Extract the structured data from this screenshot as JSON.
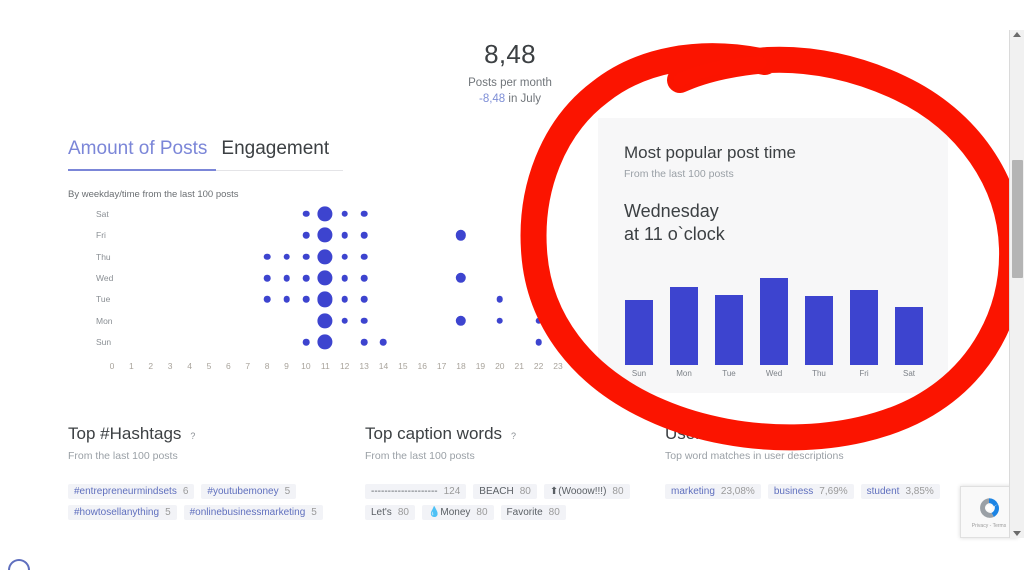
{
  "kpi": {
    "value": "8,48",
    "label": "Posts per month",
    "delta_value": "-8,48",
    "delta_suffix": " in July"
  },
  "tabs": [
    {
      "label": "Amount of Posts",
      "active": true
    },
    {
      "label": "Engagement",
      "active": false
    }
  ],
  "bubble_chart_caption": "By weekday/time from the last 100 posts",
  "popular_card": {
    "title": "Most popular post time",
    "subtitle": "From the last 100 posts",
    "headline_line1": "Wednesday",
    "headline_line2": "at 11 o`clock"
  },
  "sections": [
    {
      "title": "Top #Hashtags",
      "help": "?",
      "subtitle": "From the last 100 posts",
      "chips": [
        {
          "label": "#entrepreneurmindsets",
          "count": "6",
          "style": "link"
        },
        {
          "label": "#youtubemoney",
          "count": "5",
          "style": "link"
        },
        {
          "label": "#howtosellanything",
          "count": "5",
          "style": "link"
        },
        {
          "label": "#onlinebusinessmarketing",
          "count": "5",
          "style": "link"
        }
      ]
    },
    {
      "title": "Top caption words",
      "help": "?",
      "subtitle": "From the last 100 posts",
      "chips": [
        {
          "label": "--------------------",
          "count": "124",
          "style": "plain"
        },
        {
          "label": "BEACH",
          "count": "80",
          "style": "plain"
        },
        {
          "label": "⬆(Wooow!!!)",
          "count": "80",
          "style": "plain"
        },
        {
          "label": "Let's",
          "count": "80",
          "style": "plain"
        },
        {
          "label": "💧Money",
          "count": "80",
          "style": "plain"
        },
        {
          "label": "Favorite",
          "count": "80",
          "style": "plain"
        }
      ]
    },
    {
      "title": "User's interests",
      "help": "?",
      "subtitle": "Top word matches in user descriptions",
      "chips": [
        {
          "label": "marketing",
          "count": "23,08%",
          "style": "link"
        },
        {
          "label": "business",
          "count": "7,69%",
          "style": "link"
        },
        {
          "label": "student",
          "count": "3,85%",
          "style": "link"
        }
      ]
    }
  ],
  "recaptcha": {
    "privacy": "Privacy",
    "sep": "-",
    "terms": "Terms"
  },
  "colors": {
    "accent_blue": "#3d44cf",
    "tab_active": "#7b86d8",
    "annotation_red": "#fb1400",
    "chip_link": "#5f6fbe",
    "card_bg": "#f7f7f8"
  },
  "chart_data": [
    {
      "type": "scatter",
      "name": "posts-by-weekday-and-hour",
      "title": "Amount of Posts",
      "subtitle": "By weekday/time from the last 100 posts",
      "xlabel": "hour",
      "ylabel": "weekday",
      "xlim": [
        0,
        23
      ],
      "x_ticks": [
        0,
        1,
        2,
        3,
        4,
        5,
        6,
        7,
        8,
        9,
        10,
        11,
        12,
        13,
        14,
        15,
        16,
        17,
        18,
        19,
        20,
        21,
        22,
        23
      ],
      "y_categories": [
        "Sat",
        "Fri",
        "Thu",
        "Wed",
        "Tue",
        "Mon",
        "Sun"
      ],
      "grid": false,
      "legend": "none",
      "points": [
        {
          "day": "Sat",
          "hour": 10,
          "size": 1
        },
        {
          "day": "Sat",
          "hour": 11,
          "size": 3
        },
        {
          "day": "Sat",
          "hour": 12,
          "size": 1
        },
        {
          "day": "Sat",
          "hour": 13,
          "size": 1
        },
        {
          "day": "Fri",
          "hour": 10,
          "size": 1
        },
        {
          "day": "Fri",
          "hour": 11,
          "size": 3
        },
        {
          "day": "Fri",
          "hour": 12,
          "size": 1
        },
        {
          "day": "Fri",
          "hour": 13,
          "size": 1
        },
        {
          "day": "Fri",
          "hour": 18,
          "size": 2
        },
        {
          "day": "Thu",
          "hour": 8,
          "size": 1
        },
        {
          "day": "Thu",
          "hour": 9,
          "size": 1
        },
        {
          "day": "Thu",
          "hour": 10,
          "size": 1
        },
        {
          "day": "Thu",
          "hour": 11,
          "size": 3
        },
        {
          "day": "Thu",
          "hour": 12,
          "size": 1
        },
        {
          "day": "Thu",
          "hour": 13,
          "size": 1
        },
        {
          "day": "Wed",
          "hour": 8,
          "size": 1
        },
        {
          "day": "Wed",
          "hour": 9,
          "size": 1
        },
        {
          "day": "Wed",
          "hour": 10,
          "size": 1
        },
        {
          "day": "Wed",
          "hour": 11,
          "size": 3
        },
        {
          "day": "Wed",
          "hour": 12,
          "size": 1
        },
        {
          "day": "Wed",
          "hour": 13,
          "size": 1
        },
        {
          "day": "Wed",
          "hour": 18,
          "size": 2
        },
        {
          "day": "Tue",
          "hour": 8,
          "size": 1
        },
        {
          "day": "Tue",
          "hour": 9,
          "size": 1
        },
        {
          "day": "Tue",
          "hour": 10,
          "size": 1
        },
        {
          "day": "Tue",
          "hour": 11,
          "size": 3
        },
        {
          "day": "Tue",
          "hour": 12,
          "size": 1
        },
        {
          "day": "Tue",
          "hour": 13,
          "size": 1
        },
        {
          "day": "Tue",
          "hour": 20,
          "size": 1
        },
        {
          "day": "Tue",
          "hour": 22,
          "size": 1
        },
        {
          "day": "Mon",
          "hour": 11,
          "size": 3
        },
        {
          "day": "Mon",
          "hour": 12,
          "size": 1
        },
        {
          "day": "Mon",
          "hour": 13,
          "size": 1
        },
        {
          "day": "Mon",
          "hour": 18,
          "size": 2
        },
        {
          "day": "Mon",
          "hour": 20,
          "size": 1
        },
        {
          "day": "Mon",
          "hour": 22,
          "size": 1
        },
        {
          "day": "Sun",
          "hour": 10,
          "size": 1
        },
        {
          "day": "Sun",
          "hour": 11,
          "size": 3
        },
        {
          "day": "Sun",
          "hour": 13,
          "size": 1
        },
        {
          "day": "Sun",
          "hour": 14,
          "size": 1
        },
        {
          "day": "Sun",
          "hour": 22,
          "size": 1
        }
      ]
    },
    {
      "type": "bar",
      "name": "most-popular-post-time",
      "title": "Most popular post time",
      "subtitle": "From the last 100 posts",
      "xlabel": "",
      "ylabel": "",
      "categories": [
        "Sun",
        "Mon",
        "Tue",
        "Wed",
        "Thu",
        "Fri",
        "Sat"
      ],
      "values": [
        68,
        82,
        74,
        92,
        73,
        79,
        61
      ],
      "ylim": [
        0,
        100
      ],
      "grid": false,
      "legend": "none"
    }
  ]
}
